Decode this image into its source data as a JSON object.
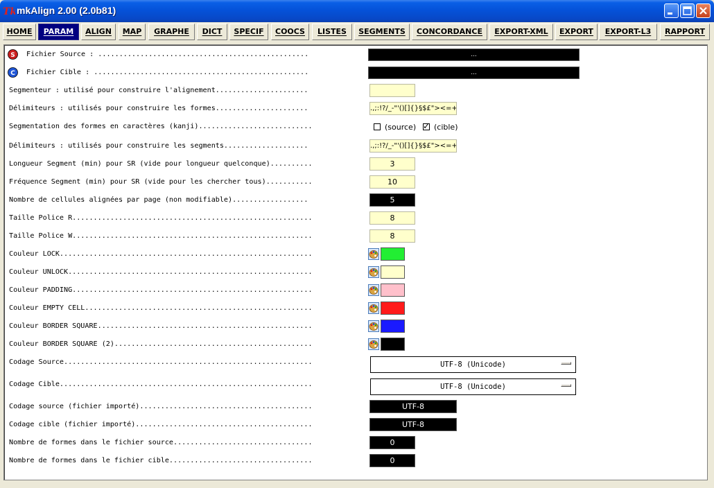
{
  "window": {
    "title": "mkAlign 2.00 (2.0b81)"
  },
  "tabs": [
    {
      "label": "HOME",
      "active": false
    },
    {
      "label": "PARAM",
      "active": true
    },
    {
      "label": "ALIGN",
      "active": false
    },
    {
      "label": "MAP",
      "active": false
    },
    {
      "label": "GRAPHE",
      "active": false
    },
    {
      "label": "DICT",
      "active": false
    },
    {
      "label": "SPECIF",
      "active": false
    },
    {
      "label": "COOCS",
      "active": false
    },
    {
      "label": "LISTES",
      "active": false
    },
    {
      "label": "SEGMENTS",
      "active": false
    },
    {
      "label": "CONCORDANCE",
      "active": false
    },
    {
      "label": "EXPORT-XML",
      "active": false
    },
    {
      "label": "EXPORT",
      "active": false
    },
    {
      "label": "EXPORT-L3",
      "active": false
    },
    {
      "label": "RAPPORT",
      "active": false
    }
  ],
  "params": {
    "source_file": {
      "label": "Fichier Source : ..................................................",
      "value": "...",
      "icon_letter": "S",
      "icon_color": "#cc1f1f"
    },
    "target_file": {
      "label": "Fichier Cible : ...................................................",
      "value": "...",
      "icon_letter": "C",
      "icon_color": "#1f55d6"
    },
    "segmenter": {
      "label": "Segmenteur : utilisé pour construire l'alignement......................",
      "value": ""
    },
    "form_delims": {
      "label": "Délimiteurs : utilisés pour construire les formes......................",
      "value": ".,;:!?/_-\"'()[]{}§$£\"><=+#"
    },
    "kanji": {
      "label": "Segmentation des formes en caractères (kanji)...........................",
      "source_label": "(source)",
      "source_checked": false,
      "target_label": "(cible)",
      "target_checked": true
    },
    "segment_delims": {
      "label": "Délimiteurs : utilisés pour construire les segments....................",
      "value": ".,;:!?/_-\"'()[]{}§$£\"><=+#"
    },
    "seg_length": {
      "label": "Longueur Segment (min) pour SR (vide pour longueur quelconque)..........",
      "value": "3"
    },
    "seg_freq": {
      "label": "Fréquence Segment (min) pour SR (vide pour les chercher tous)...........",
      "value": "10"
    },
    "cells_per_page": {
      "label": "Nombre de cellules alignées par page (non modifiable)..................",
      "value": "5"
    },
    "font_r": {
      "label": "Taille Police R.........................................................",
      "value": "8"
    },
    "font_w": {
      "label": "Taille Police W.........................................................",
      "value": "8"
    },
    "colors": [
      {
        "label": "Couleur LOCK............................................................",
        "color": "#22ee33"
      },
      {
        "label": "Couleur UNLOCK..........................................................",
        "color": "#ffffcc"
      },
      {
        "label": "Couleur PADDING.........................................................",
        "color": "#ffc0cb"
      },
      {
        "label": "Couleur EMPTY CELL......................................................",
        "color": "#ff1a1a"
      },
      {
        "label": "Couleur BORDER SQUARE...................................................",
        "color": "#1a1aff"
      },
      {
        "label": "Couleur BORDER SQUARE (2)...............................................",
        "color": "#000000"
      }
    ],
    "encoding_source": {
      "label": "Codage Source...........................................................",
      "value": "UTF-8 (Unicode)"
    },
    "encoding_target": {
      "label": "Codage Cible............................................................",
      "value": "UTF-8 (Unicode)"
    },
    "import_enc_source": {
      "label": "Codage source (fichier importé).........................................",
      "value": "UTF-8"
    },
    "import_enc_target": {
      "label": "Codage cible (fichier importé)..........................................",
      "value": "UTF-8"
    },
    "forms_source": {
      "label": "Nombre de formes dans le fichier source.................................",
      "value": "0"
    },
    "forms_target": {
      "label": "Nombre de formes dans le fichier cible..................................",
      "value": "0"
    }
  }
}
